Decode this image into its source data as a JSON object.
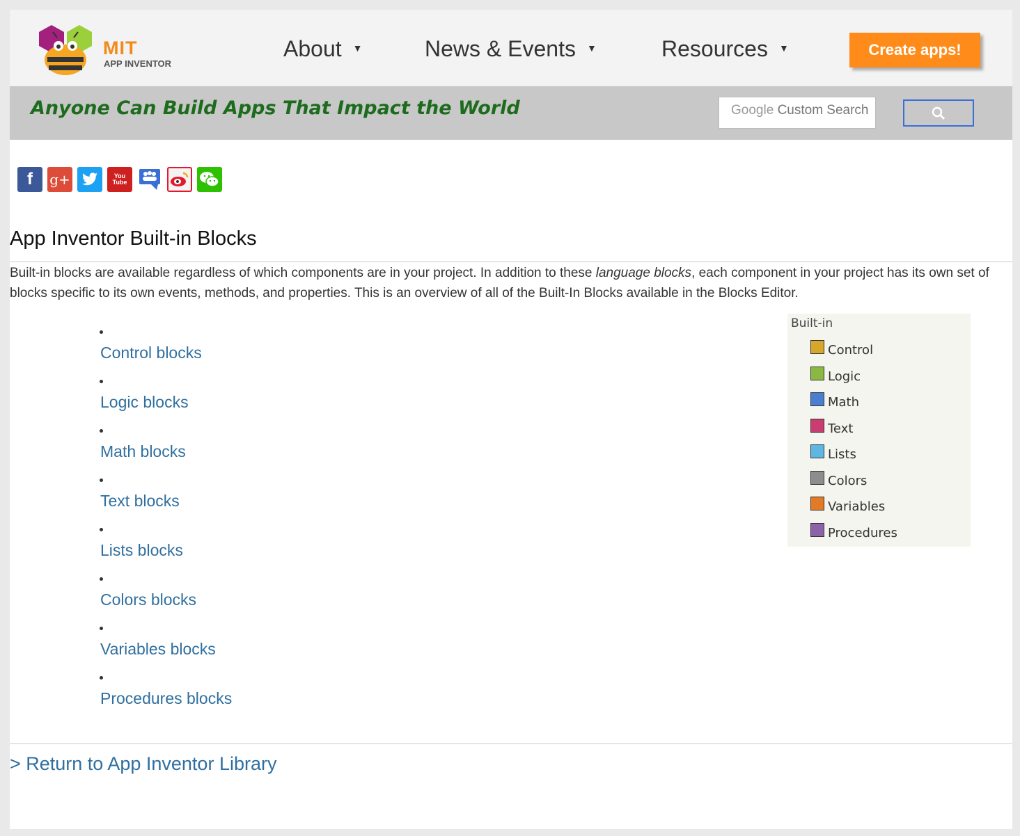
{
  "header": {
    "logo": {
      "mit": "MIT",
      "sub": "APP INVENTOR"
    },
    "nav": [
      {
        "label": "About"
      },
      {
        "label": "News & Events"
      },
      {
        "label": "Resources"
      }
    ],
    "caret": "▼",
    "cta_label": "Create apps!"
  },
  "banner": {
    "tagline": "Anyone Can Build Apps That Impact the World",
    "search_brand": "Google",
    "search_placeholder": "Custom Search"
  },
  "social": [
    {
      "name": "facebook-icon",
      "glyph": "f",
      "color": "#3b5998"
    },
    {
      "name": "google-plus-icon",
      "glyph": "g+",
      "color": "#dd4b39"
    },
    {
      "name": "twitter-icon",
      "glyph": "t",
      "color": "#1da1f2"
    },
    {
      "name": "youtube-icon",
      "glyph": "You Tube",
      "color": "#cd201f"
    },
    {
      "name": "community-icon",
      "glyph": "",
      "color": "#3a6fd8"
    },
    {
      "name": "weibo-icon",
      "glyph": "",
      "color": "#e6162d"
    },
    {
      "name": "wechat-icon",
      "glyph": "",
      "color": "#2dc100"
    }
  ],
  "content": {
    "title": "App Inventor Built-in Blocks",
    "intro_before": "Built-in blocks are available regardless of which components are in your project. In addition to these ",
    "intro_italic": "language blocks",
    "intro_after": ", each component in your project has its own set of blocks specific to its own events, methods, and properties. This is an overview of all of the Built-In Blocks available in the Blocks Editor.",
    "blocks": [
      "Control blocks",
      "Logic blocks",
      "Math blocks",
      "Text blocks",
      "Lists blocks",
      "Colors blocks",
      "Variables blocks",
      "Procedures blocks"
    ]
  },
  "legend": {
    "title": "Built-in",
    "items": [
      {
        "label": "Control",
        "color": "#d6a72a"
      },
      {
        "label": "Logic",
        "color": "#8bb843"
      },
      {
        "label": "Math",
        "color": "#4a7fd0"
      },
      {
        "label": "Text",
        "color": "#c93d72"
      },
      {
        "label": "Lists",
        "color": "#5eb6e3"
      },
      {
        "label": "Colors",
        "color": "#8d8d8d"
      },
      {
        "label": "Variables",
        "color": "#e27a26"
      },
      {
        "label": "Procedures",
        "color": "#8c63a8"
      }
    ]
  },
  "footer": {
    "return_link": "> Return to App Inventor Library"
  }
}
